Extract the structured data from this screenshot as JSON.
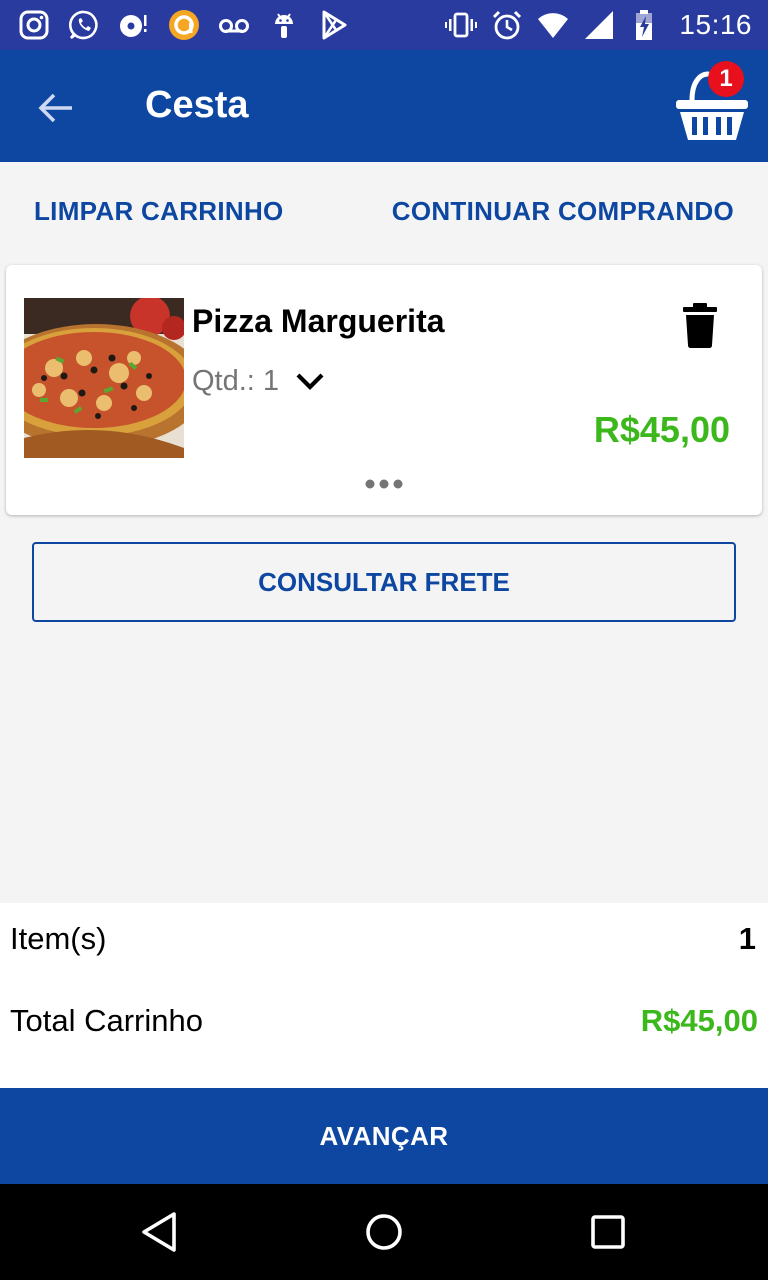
{
  "status_bar": {
    "time": "15:16",
    "left_icons": [
      "instagram-icon",
      "whatsapp-icon",
      "media-notification-icon",
      "app-notification-icon",
      "voicemail-icon",
      "android-icon",
      "play-store-icon"
    ],
    "right_icons": [
      "vibrate-icon",
      "alarm-icon",
      "wifi-icon",
      "cell-signal-icon",
      "battery-charging-icon"
    ]
  },
  "app_bar": {
    "title": "Cesta",
    "cart_badge": "1",
    "color": "#0d47a1"
  },
  "actions": {
    "clear_cart": "LIMPAR CARRINHO",
    "continue_shopping": "CONTINUAR COMPRANDO"
  },
  "cart_items": [
    {
      "name": "Pizza Marguerita",
      "qty_label": "Qtd.:",
      "qty_value": "1",
      "price": "R$45,00"
    }
  ],
  "freight_button": "CONSULTAR FRETE",
  "summary": {
    "items_label": "Item(s)",
    "items_value": "1",
    "total_label": "Total Carrinho",
    "total_value": "R$45,00"
  },
  "advance_button": "AVANÇAR",
  "colors": {
    "primary": "#0d47a1",
    "status_bar": "#2a3ba0",
    "price_green": "#3cb81d",
    "badge_red": "#e8101d"
  }
}
